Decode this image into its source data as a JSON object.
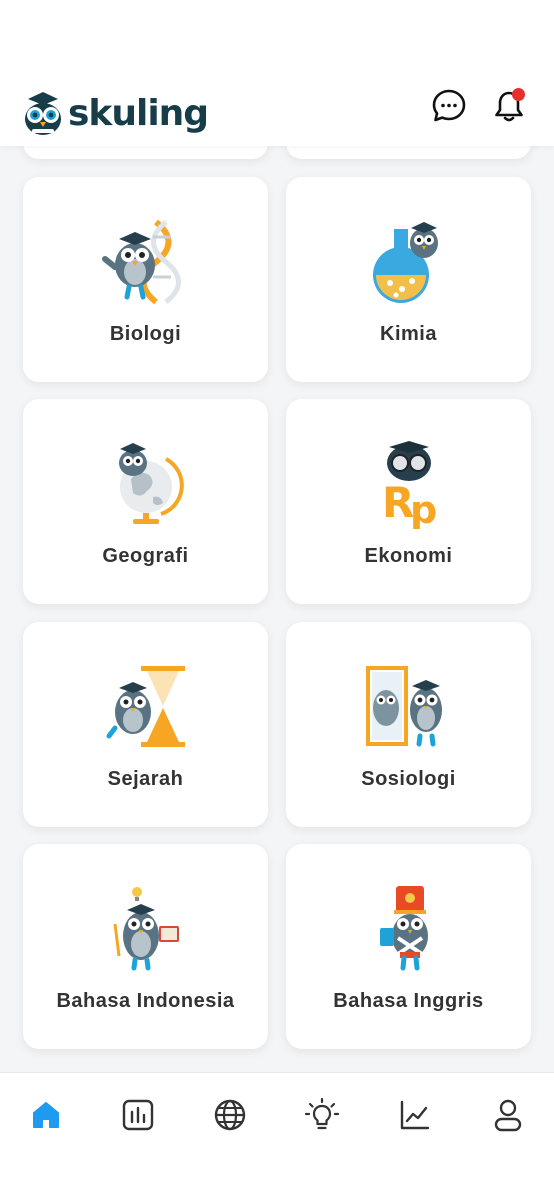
{
  "app": {
    "name": "skuling"
  },
  "subjects": [
    {
      "label": "Biologi",
      "icon": "owl-dna-icon"
    },
    {
      "label": "Kimia",
      "icon": "owl-flask-icon"
    },
    {
      "label": "Geografi",
      "icon": "owl-globe-icon"
    },
    {
      "label": "Ekonomi",
      "icon": "owl-rp-icon"
    },
    {
      "label": "Sejarah",
      "icon": "owl-hourglass-icon"
    },
    {
      "label": "Sosiologi",
      "icon": "owl-mirror-icon"
    },
    {
      "label": "Bahasa Indonesia",
      "icon": "owl-book-icon"
    },
    {
      "label": "Bahasa Inggris",
      "icon": "owl-soldier-icon"
    }
  ],
  "nav": {
    "active": "home",
    "items": [
      "home",
      "report",
      "globe",
      "idea",
      "stats",
      "profile"
    ]
  },
  "colors": {
    "active_nav": "#1e9bf0",
    "inactive_nav": "#333333",
    "brand": "#173c4a",
    "notification": "#e5302e"
  }
}
